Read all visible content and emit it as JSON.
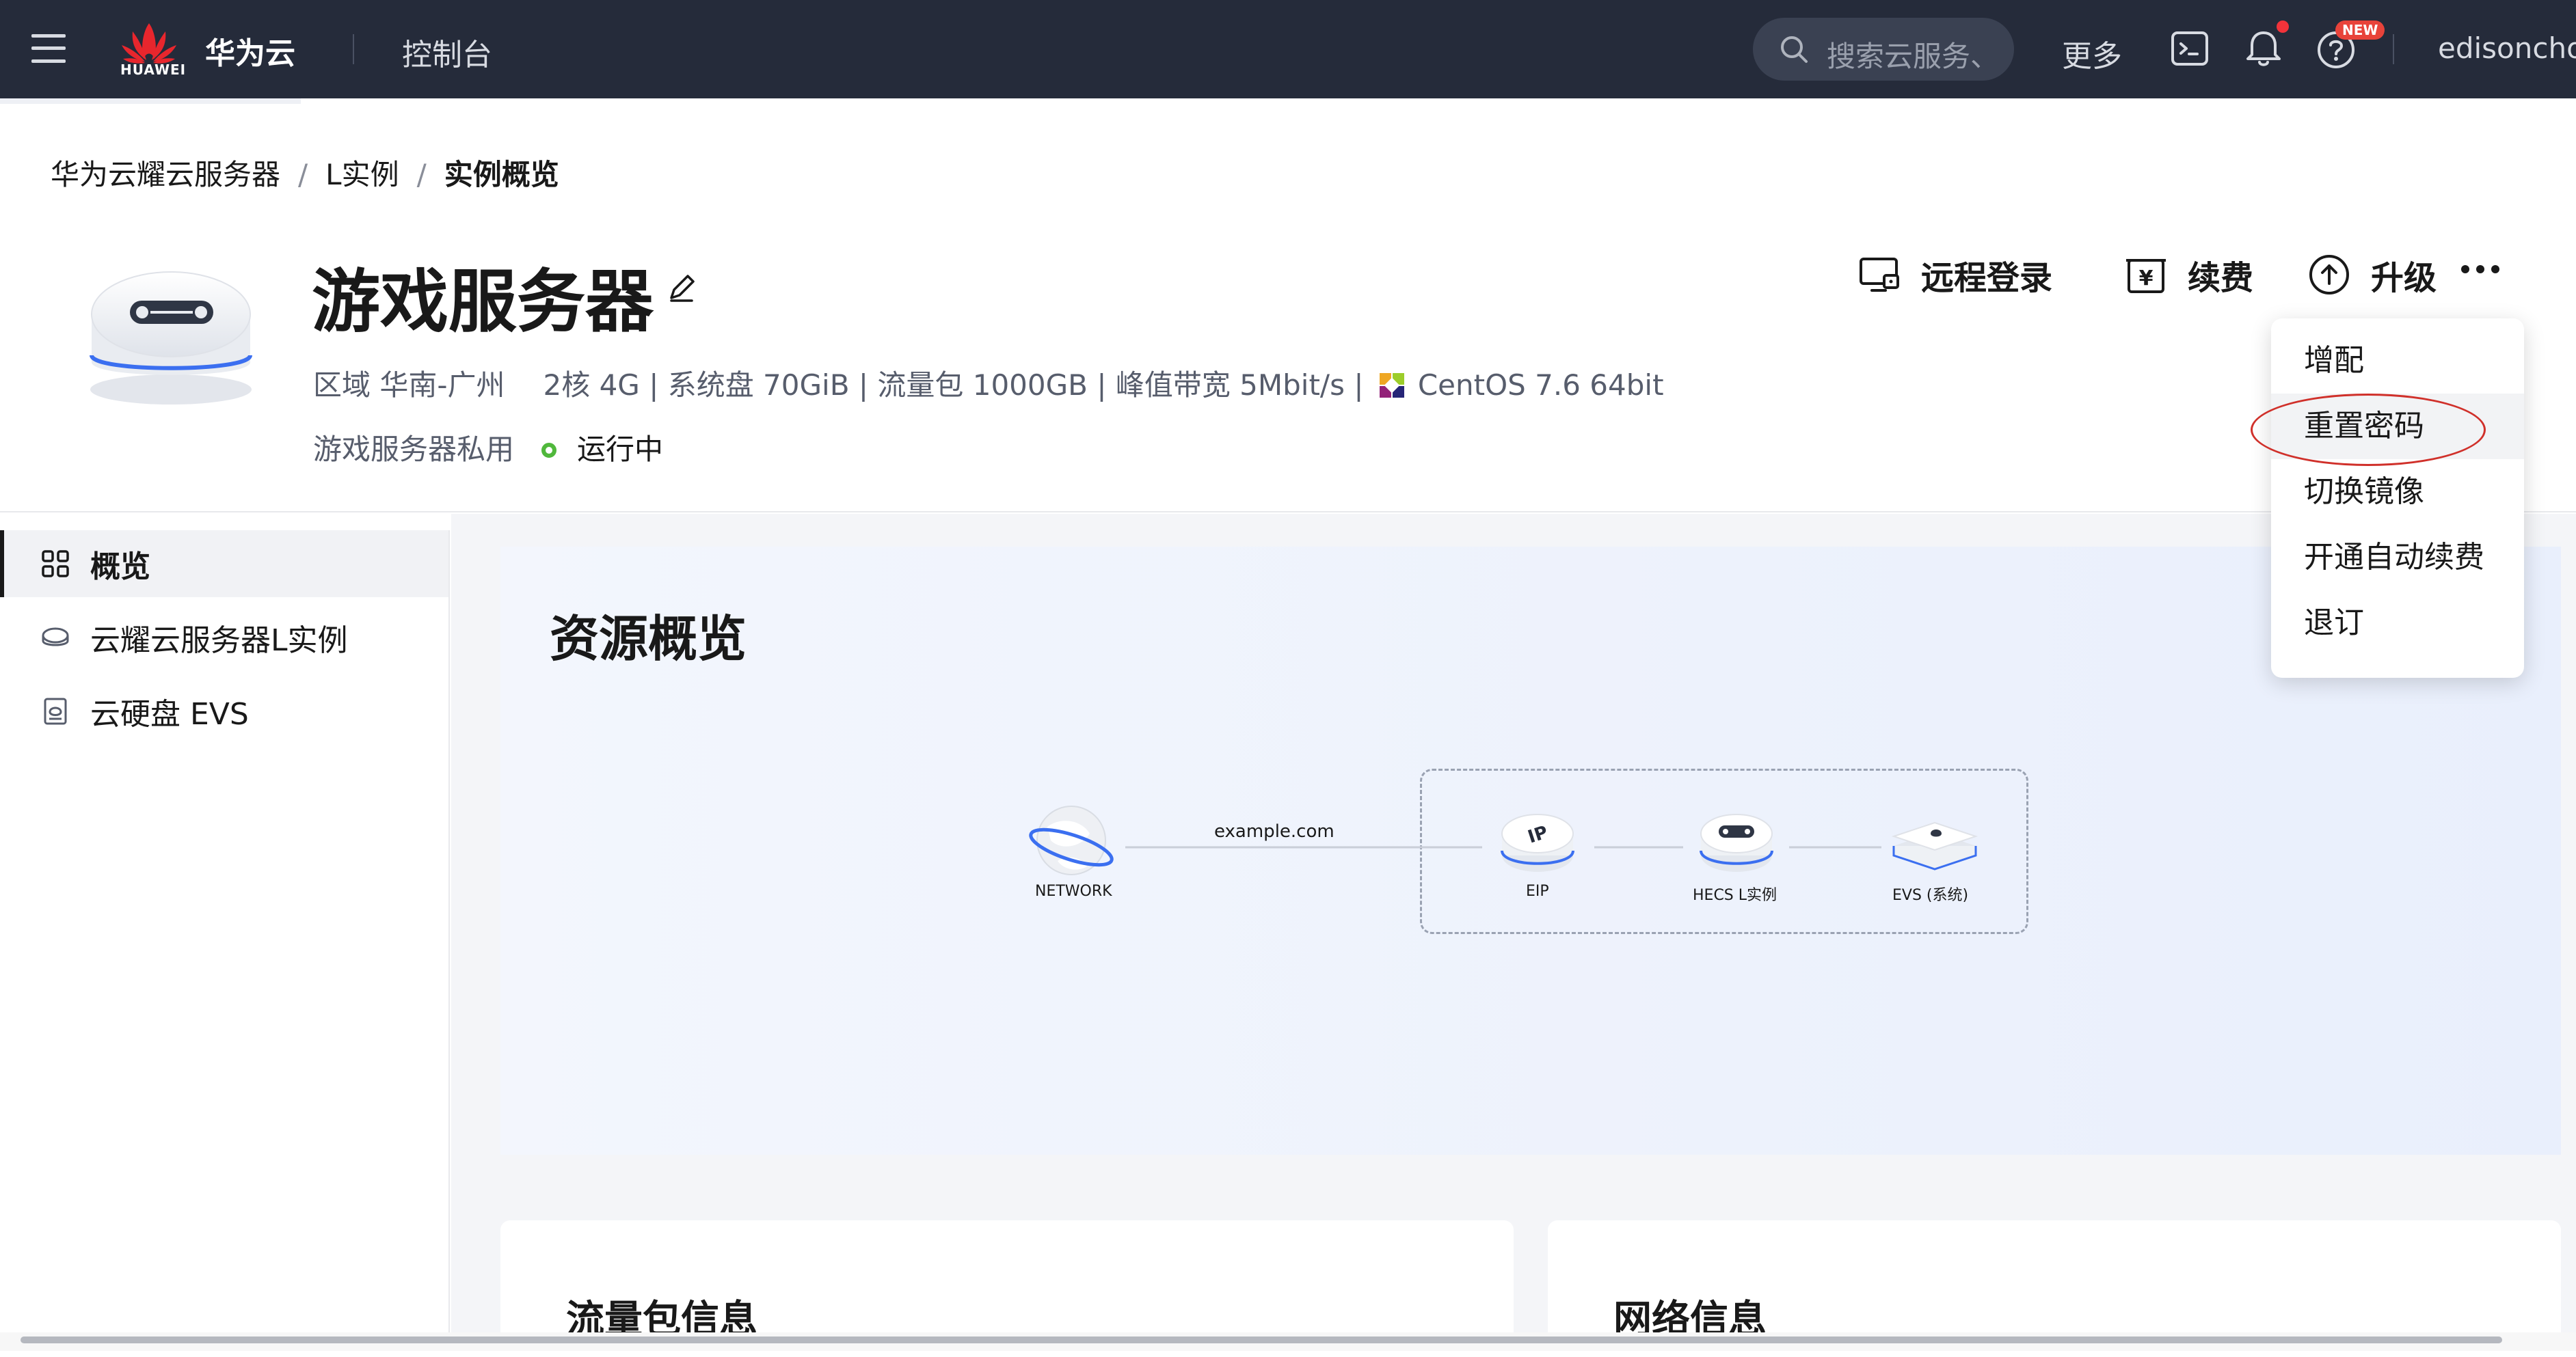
{
  "topbar": {
    "logo_text": "HUAWEI",
    "brand": "华为云",
    "console": "控制台",
    "search_placeholder": "搜索云服务、",
    "more": "更多",
    "new_badge": "NEW",
    "user": "edisonchoi"
  },
  "breadcrumb": [
    "华为云耀云服务器",
    "L实例",
    "实例概览"
  ],
  "instance": {
    "name": "游戏服务器",
    "region": "区域 华南-广州",
    "specs": "2核 4G | 系统盘 70GiB | 流量包 1000GB | 峰值带宽 5Mbit/s |",
    "os": "CentOS 7.6 64bit",
    "description": "游戏服务器私用",
    "status": "运行中"
  },
  "actions": {
    "remote_login": "远程登录",
    "renew": "续费",
    "upgrade": "升级"
  },
  "dropdown": {
    "items": [
      "增配",
      "重置密码",
      "切换镜像",
      "开通自动续费",
      "退订"
    ],
    "highlighted": "重置密码"
  },
  "sidebar": {
    "items": [
      {
        "label": "概览",
        "icon": "grid-icon"
      },
      {
        "label": "云耀云服务器L实例",
        "icon": "cloud-server-icon"
      },
      {
        "label": "云硬盘 EVS",
        "icon": "disk-icon"
      }
    ]
  },
  "overview": {
    "title": "资源概览",
    "edge_label": "example.com",
    "nodes": [
      "NETWORK",
      "EIP",
      "HECS L实例",
      "EVS (系统)"
    ]
  },
  "cards": {
    "traffic": "流量包信息",
    "network": "网络信息"
  },
  "colors": {
    "topbar": "#252b3a",
    "status_running": "#50b83c",
    "annotation": "#d0302a",
    "accent_blue": "#3b6ff0"
  }
}
